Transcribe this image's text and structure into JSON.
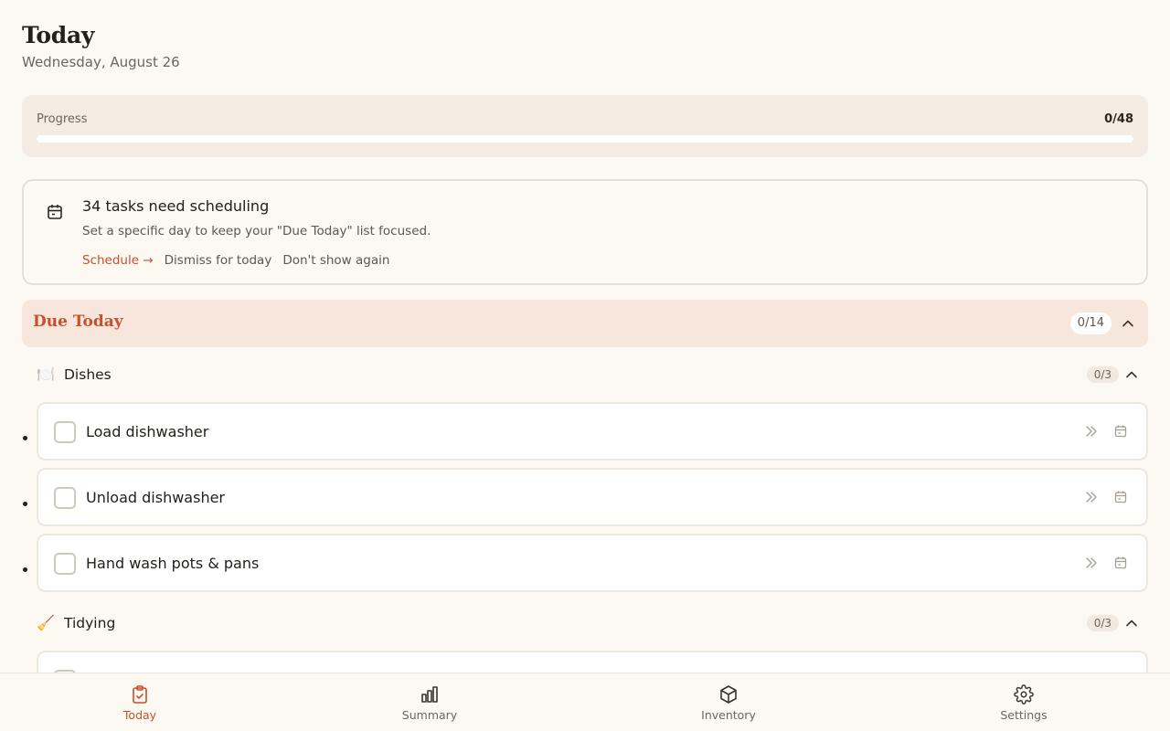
{
  "header": {
    "title": "Today",
    "date": "Wednesday, August 26"
  },
  "progress": {
    "label": "Progress",
    "count": "0/48",
    "fraction": 0
  },
  "notice": {
    "icon": "calendar-icon",
    "title": "34 tasks need scheduling",
    "description": "Set a specific day to keep your \"Due Today\" list focused.",
    "actions": {
      "schedule": "Schedule →",
      "dismiss": "Dismiss for today",
      "never": "Don't show again"
    }
  },
  "section": {
    "title": "Due Today",
    "count": "0/14"
  },
  "groups": [
    {
      "emoji": "🍽️",
      "label": "Dishes",
      "count": "0/3",
      "tasks": [
        {
          "label": "Load dishwasher"
        },
        {
          "label": "Unload dishwasher"
        },
        {
          "label": "Hand wash pots & pans"
        }
      ]
    },
    {
      "emoji": "🧹",
      "label": "Tidying",
      "count": "0/3",
      "tasks": []
    }
  ],
  "nav": [
    {
      "label": "Today",
      "icon": "clipboard-check-icon",
      "active": true
    },
    {
      "label": "Summary",
      "icon": "bar-chart-icon",
      "active": false
    },
    {
      "label": "Inventory",
      "icon": "box-icon",
      "active": false
    },
    {
      "label": "Settings",
      "icon": "gear-icon",
      "active": false
    }
  ],
  "colors": {
    "accent": "#c8502e",
    "background": "#fcf8f2",
    "section_bg": "#f6e6dc",
    "progress_bg": "#f4ebe2"
  }
}
